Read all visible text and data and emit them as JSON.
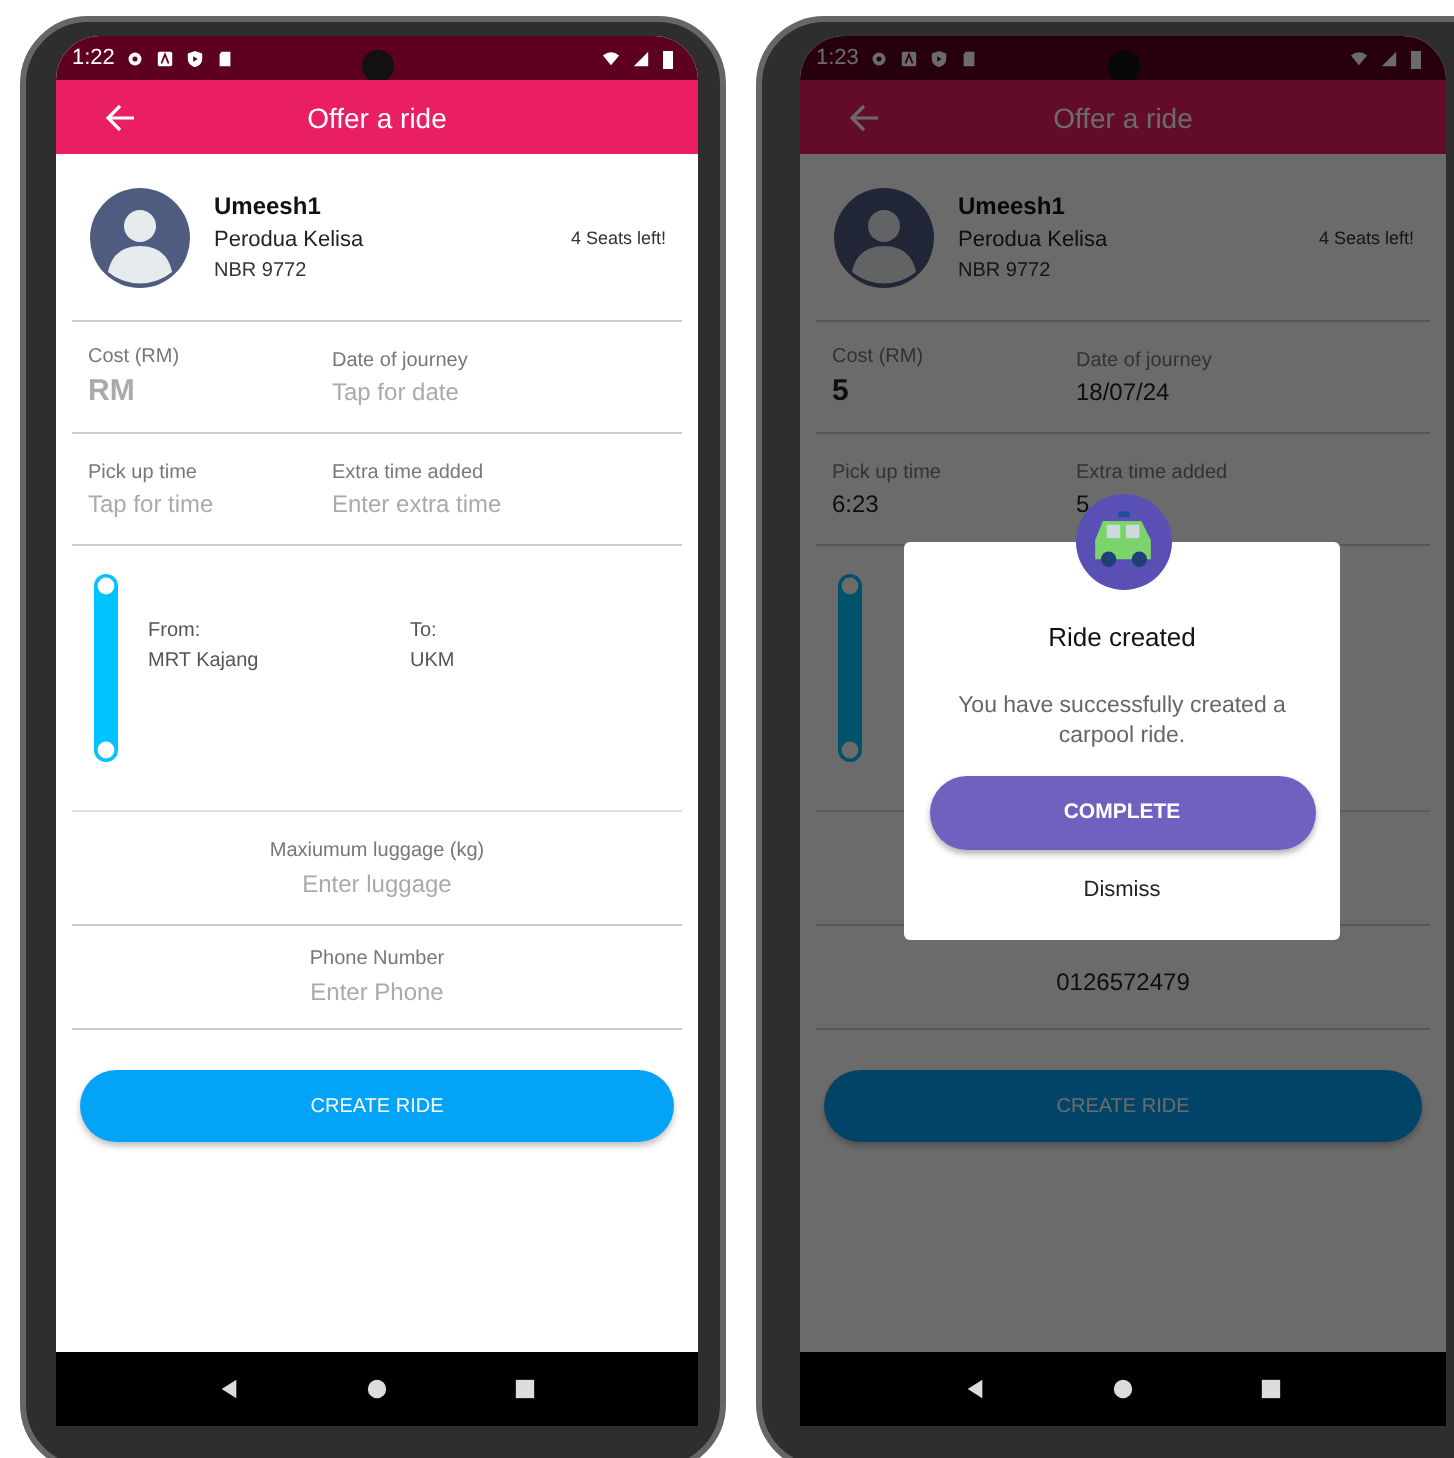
{
  "phones": [
    {
      "status_time": "1:22",
      "title": "Offer a ride",
      "profile": {
        "name": "Umeesh1",
        "car": "Perodua Kelisa",
        "plate": "NBR 9772",
        "seats": "4 Seats left!"
      },
      "field_rows": [
        [
          {
            "label": "Cost (RM)",
            "placeholder": "RM",
            "kind": "amount"
          },
          {
            "label": "Date of journey",
            "placeholder": "Tap for date",
            "kind": "text"
          }
        ],
        [
          {
            "label": "Pick up time",
            "placeholder": "Tap for time",
            "kind": "text"
          },
          {
            "label": "Extra time added",
            "placeholder": "Enter extra time",
            "kind": "text"
          }
        ]
      ],
      "route": {
        "from_label": "From:",
        "from": "MRT Kajang",
        "to_label": "To:",
        "to": "UKM"
      },
      "luggage": {
        "label": "Maxiumum luggage (kg)",
        "placeholder": "Enter luggage"
      },
      "phone": {
        "label": "Phone Number",
        "placeholder": "Enter Phone"
      },
      "button": "CREATE RIDE"
    },
    {
      "status_time": "1:23",
      "title": "Offer a ride",
      "profile": {
        "name": "Umeesh1",
        "car": "Perodua Kelisa",
        "plate": "NBR 9772",
        "seats": "4 Seats left!"
      },
      "field_rows": [
        [
          {
            "label": "Cost (RM)",
            "value": "5",
            "kind": "amount"
          },
          {
            "label": "Date of journey",
            "value": "18/07/24",
            "kind": "text"
          }
        ],
        [
          {
            "label": "Pick up time",
            "value": "6:23",
            "kind": "text"
          },
          {
            "label": "Extra time added",
            "value": "5",
            "kind": "text"
          }
        ]
      ],
      "phone": {
        "value": "0126572479"
      },
      "button": "CREATE RIDE",
      "dialog": {
        "title": "Ride created",
        "message": "You have successfully created a carpool ride.",
        "primary": "COMPLETE",
        "secondary": "Dismiss"
      }
    }
  ]
}
